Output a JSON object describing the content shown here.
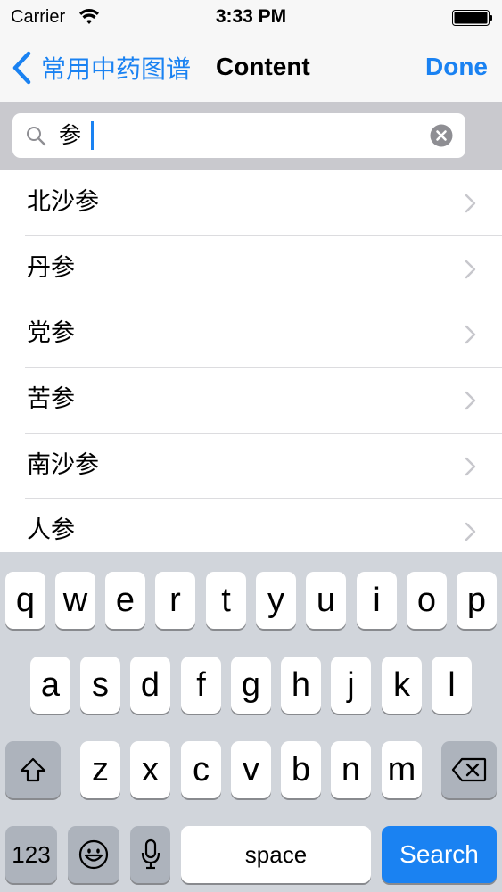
{
  "status_bar": {
    "carrier": "Carrier",
    "time": "3:33 PM",
    "icons": [
      "wifi-icon",
      "battery-icon"
    ]
  },
  "nav_bar": {
    "back_label": "常用中药图谱",
    "title": "Content",
    "done_label": "Done",
    "accent_color": "#1a82f2"
  },
  "search": {
    "value": "参",
    "icons": [
      "search-icon",
      "clear-icon"
    ]
  },
  "results": [
    {
      "label": "北沙参"
    },
    {
      "label": "丹参"
    },
    {
      "label": "党参"
    },
    {
      "label": "苦参"
    },
    {
      "label": "南沙参"
    },
    {
      "label": "人参"
    }
  ],
  "keyboard": {
    "row1": [
      "q",
      "w",
      "e",
      "r",
      "t",
      "y",
      "u",
      "i",
      "o",
      "p"
    ],
    "row2": [
      "a",
      "s",
      "d",
      "f",
      "g",
      "h",
      "j",
      "k",
      "l"
    ],
    "row3": [
      "z",
      "x",
      "c",
      "v",
      "b",
      "n",
      "m"
    ],
    "numbers_label": "123",
    "space_label": "space",
    "search_label": "Search",
    "icons": [
      "shift-icon",
      "backspace-icon",
      "emoji-icon",
      "microphone-icon"
    ]
  }
}
